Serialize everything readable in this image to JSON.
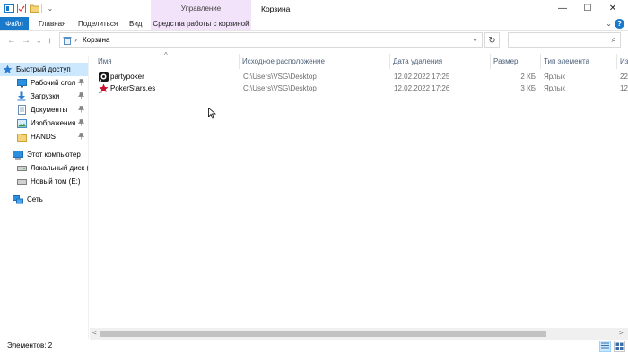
{
  "window": {
    "title": "Корзина",
    "context_group": "Управление",
    "controls": {
      "minimize": "—",
      "maximize": "☐",
      "close": "✕"
    }
  },
  "ribbon": {
    "tabs": [
      "Файл",
      "Главная",
      "Поделиться",
      "Вид",
      "Средства работы с корзиной"
    ],
    "expand": "⌄",
    "help": "?"
  },
  "nav": {
    "back": "←",
    "forward": "→",
    "recent": "⌄",
    "up": "↑"
  },
  "address": {
    "separator": "›",
    "path": "Корзина",
    "dropdown": "⌄",
    "refresh": "↻"
  },
  "search": {
    "placeholder": "",
    "icon": "⌕"
  },
  "sidebar": {
    "items": [
      {
        "label": "Быстрый доступ",
        "icon": "star-icon",
        "pinned": false
      },
      {
        "label": "Рабочий стол",
        "icon": "desktop-icon",
        "pinned": true
      },
      {
        "label": "Загрузки",
        "icon": "download-icon",
        "pinned": true
      },
      {
        "label": "Документы",
        "icon": "documents-icon",
        "pinned": true
      },
      {
        "label": "Изображения",
        "icon": "pictures-icon",
        "pinned": true
      },
      {
        "label": "HANDS",
        "icon": "folder-icon",
        "pinned": true
      },
      {
        "label": "Этот компьютер",
        "icon": "computer-icon",
        "pinned": false
      },
      {
        "label": "Локальный диск (C",
        "icon": "drive-icon",
        "pinned": false
      },
      {
        "label": "Новый том (E:)",
        "icon": "drive-icon",
        "pinned": false
      },
      {
        "label": "Сеть",
        "icon": "network-icon",
        "pinned": false
      }
    ],
    "pin_glyph": "📌"
  },
  "columns": {
    "name": "Имя",
    "origin": "Исходное расположение",
    "date": "Дата удаления",
    "size": "Размер",
    "type": "Тип элемента",
    "extra": "Из"
  },
  "files": [
    {
      "name": "partypoker",
      "origin": "C:\\Users\\VSG\\Desktop",
      "date": "12.02.2022 17:25",
      "size": "2 КБ",
      "type": "Ярлык",
      "extra": "22",
      "color": "#202020"
    },
    {
      "name": "PokerStars.es",
      "origin": "C:\\Users\\VSG\\Desktop",
      "date": "12.02.2022 17:26",
      "size": "3 КБ",
      "type": "Ярлык",
      "extra": "12",
      "color": "#c8102e"
    }
  ],
  "scrollbar": {
    "left": "<",
    "right": ">"
  },
  "status": {
    "items_count": "Элементов: 2"
  },
  "colors": {
    "accent": "#1979ca",
    "context": "#f2e3fa",
    "selected": "#cce8ff"
  }
}
